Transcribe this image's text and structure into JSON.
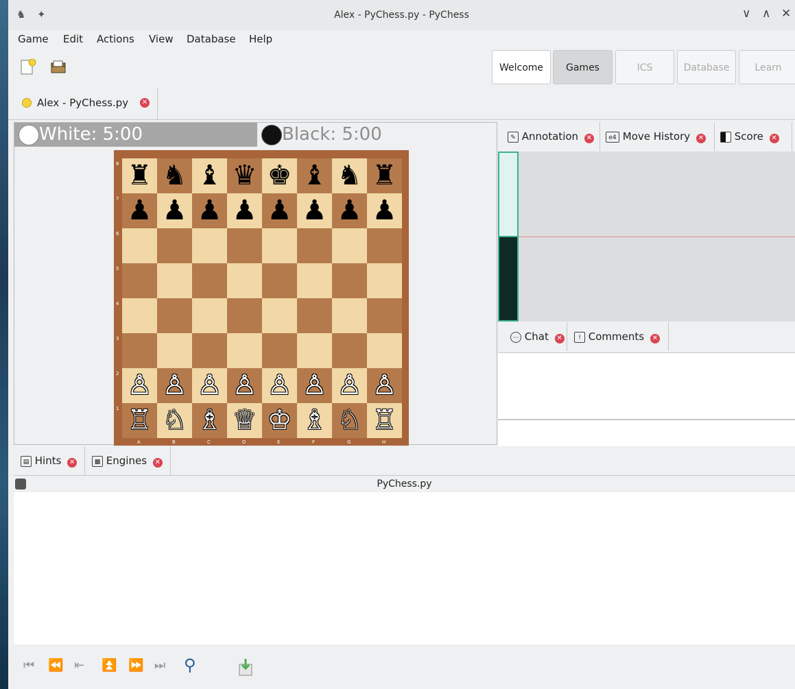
{
  "window": {
    "title": "Alex - PyChess.py - PyChess"
  },
  "menu": [
    "Game",
    "Edit",
    "Actions",
    "View",
    "Database",
    "Help"
  ],
  "perspectives": [
    "Welcome",
    "Games",
    "ICS",
    "Database",
    "Learn"
  ],
  "doc_tab": {
    "label": "Alex - PyChess.py"
  },
  "clocks": {
    "white": "White: 5:00",
    "black": "Black: 5:00"
  },
  "board": {
    "files": [
      "A",
      "B",
      "C",
      "D",
      "E",
      "F",
      "G",
      "H"
    ],
    "ranks": [
      "8",
      "7",
      "6",
      "5",
      "4",
      "3",
      "2",
      "1"
    ],
    "rows": [
      [
        "♜",
        "♞",
        "♝",
        "♛",
        "♚",
        "♝",
        "♞",
        "♜"
      ],
      [
        "♟",
        "♟",
        "♟",
        "♟",
        "♟",
        "♟",
        "♟",
        "♟"
      ],
      [
        "",
        "",
        "",
        "",
        "",
        "",
        "",
        ""
      ],
      [
        "",
        "",
        "",
        "",
        "",
        "",
        "",
        ""
      ],
      [
        "",
        "",
        "",
        "",
        "",
        "",
        "",
        ""
      ],
      [
        "",
        "",
        "",
        "",
        "",
        "",
        "",
        ""
      ],
      [
        "♙",
        "♙",
        "♙",
        "♙",
        "♙",
        "♙",
        "♙",
        "♙"
      ],
      [
        "♖",
        "♘",
        "♗",
        "♕",
        "♔",
        "♗",
        "♘",
        "♖"
      ]
    ]
  },
  "right_tabs": [
    {
      "label": "Annotation",
      "icon": "pen-icon"
    },
    {
      "label": "Move History",
      "icon": "e4"
    },
    {
      "label": "Score",
      "icon": "score-icon"
    }
  ],
  "chat_tabs": [
    {
      "label": "Chat",
      "icon": "chat-icon"
    },
    {
      "label": "Comments",
      "icon": "!"
    }
  ],
  "bottom_tabs": [
    {
      "label": "Hints",
      "icon": "hints-icon"
    },
    {
      "label": "Engines",
      "icon": "engines-icon"
    }
  ],
  "hints": {
    "engine_label": "PyChess.py"
  },
  "colors": {
    "accent_teal": "#3daf8f",
    "close_red": "#da4453"
  }
}
